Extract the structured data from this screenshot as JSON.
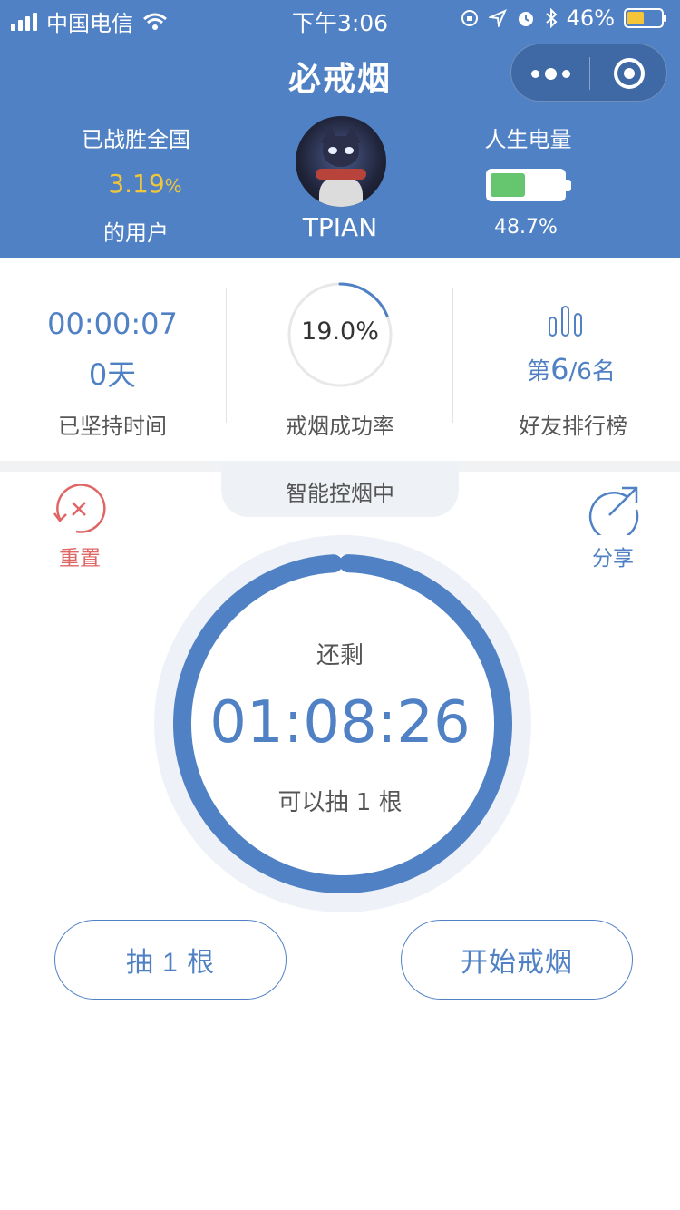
{
  "status_bar": {
    "carrier": "中国电信",
    "time": "下午3:06",
    "battery": "46%"
  },
  "app": {
    "title": "必戒烟"
  },
  "profile": {
    "beat_label": "已战胜全国",
    "beat_percent": "3.19",
    "beat_percent_unit": "%",
    "beat_suffix": "的用户",
    "username": "TPIAN",
    "life_label": "人生电量",
    "life_percent": "48.7%",
    "life_level": 0.487
  },
  "stats": {
    "elapsed_time": "00:00:07",
    "elapsed_days": "0天",
    "elapsed_label": "已坚持时间",
    "success_rate": "19.0%",
    "success_rate_value": 0.19,
    "success_label": "戒烟成功率",
    "rank_prefix": "第",
    "rank_position": "6",
    "rank_suffix": "/6名",
    "rank_label": "好友排行榜"
  },
  "control": {
    "mode": "智能控烟中",
    "reset_label": "重置",
    "share_label": "分享",
    "remain_label": "还剩",
    "countdown": "01:08:26",
    "allowance": "可以抽 1 根",
    "countdown_progress": 0.985
  },
  "buttons": {
    "smoke_one": "抽 1 根",
    "start_quit": "开始戒烟"
  },
  "colors": {
    "primary": "#5081c4",
    "accent_yellow": "#f0c63d",
    "battery_green": "#66c66f",
    "reset_red": "#e06565"
  },
  "icons": {
    "reset": "reset-icon",
    "share": "share-icon",
    "rank": "bar-chart-icon"
  }
}
